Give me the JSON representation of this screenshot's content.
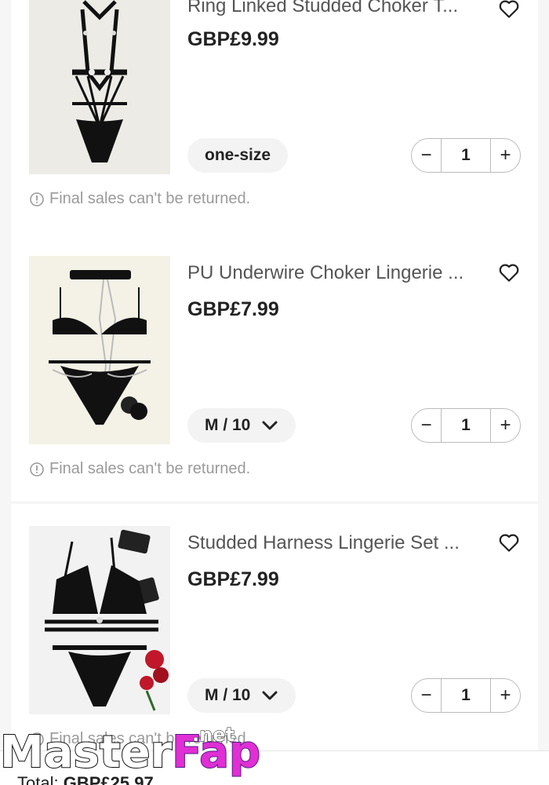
{
  "cart": {
    "items": [
      {
        "title": "Ring Linked Studded Choker T...",
        "price": "GBP£9.99",
        "size": "one-size",
        "quantity": "1",
        "notice": "Final sales can't be returned."
      },
      {
        "title": "PU Underwire Choker Lingerie ...",
        "price": "GBP£7.99",
        "size": "M / 10",
        "quantity": "1",
        "notice": "Final sales can't be returned."
      },
      {
        "title": "Studded Harness Lingerie Set ...",
        "price": "GBP£7.99",
        "size": "M / 10",
        "quantity": "1",
        "notice": "Final sales can't be returned."
      }
    ],
    "stepper": {
      "minus": "−",
      "plus": "+"
    },
    "icons": {
      "favorite": "heart-outline-icon",
      "notice": "info-circle-icon",
      "size_dropdown": "chevron-down-icon"
    }
  },
  "footer": {
    "total_label": "Total:",
    "total_value": "GBP£25.97"
  },
  "watermark": {
    "part1": "Master",
    "part2": "Fap",
    "suffix": ".net"
  },
  "colors": {
    "background": "#f6f6f6",
    "card": "#ffffff",
    "price": "#222222",
    "muted": "#9a9a9a",
    "pill": "#f3f3f3",
    "watermark_accent": "#e02fd4"
  }
}
